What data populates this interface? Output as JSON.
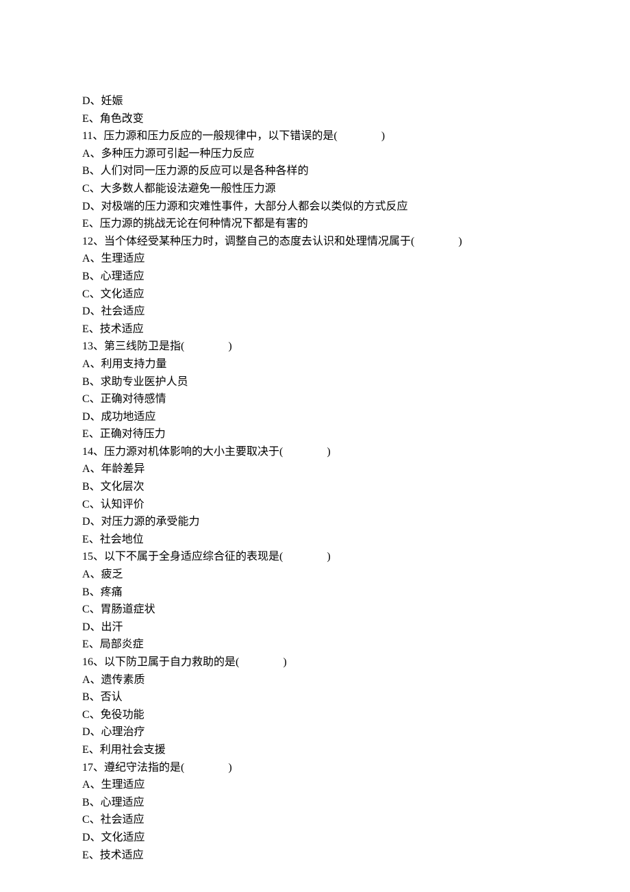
{
  "lines": [
    "D、妊娠",
    "E、角色改变",
    "11、压力源和压力反应的一般规律中，以下错误的是(　　　　)",
    "A、多种压力源可引起一种压力反应",
    "B、人们对同一压力源的反应可以是各种各样的",
    "C、大多数人都能设法避免一般性压力源",
    "D、对极端的压力源和灾难性事件，大部分人都会以类似的方式反应",
    "E、压力源的挑战无论在何种情况下都是有害的",
    "12、当个体经受某种压力时，调整自己的态度去认识和处理情况属于(　　　　)",
    "A、生理适应",
    "B、心理适应",
    "C、文化适应",
    "D、社会适应",
    "E、技术适应",
    "13、第三线防卫是指(　　　　)",
    "A、利用支持力量",
    "B、求助专业医护人员",
    "C、正确对待感情",
    "D、成功地适应",
    "E、正确对待压力",
    "14、压力源对机体影响的大小主要取决于(　　　　)",
    "A、年龄差异",
    "B、文化层次",
    "C、认知评价",
    "D、对压力源的承受能力",
    "E、社会地位",
    "15、以下不属于全身适应综合征的表现是(　　　　)",
    "A、疲乏",
    "B、疼痛",
    "C、胃肠道症状",
    "D、出汗",
    "E、局部炎症",
    "16、以下防卫属于自力救助的是(　　　　)",
    "A、遗传素质",
    "B、否认",
    "C、免役功能",
    "D、心理治疗",
    "E、利用社会支援",
    "17、遵纪守法指的是(　　　　)",
    "A、生理适应",
    "B、心理适应",
    "C、社会适应",
    "D、文化适应",
    "E、技术适应"
  ]
}
